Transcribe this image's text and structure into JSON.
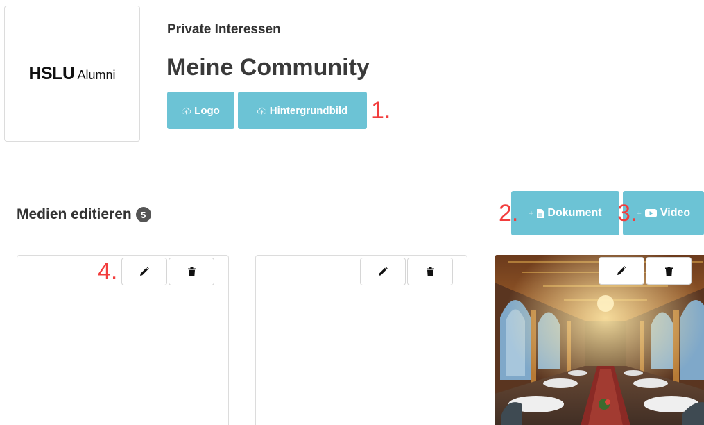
{
  "logo": {
    "main": "HSLU",
    "sub": "Alumni"
  },
  "header": {
    "subtitle": "Private Interessen",
    "title": "Meine Community"
  },
  "upload_buttons": {
    "logo_label": "Logo",
    "background_label": "Hintergrundbild",
    "icon": "cloud-upload-icon"
  },
  "annotations": {
    "a1": "1.",
    "a2": "2.",
    "a3": "3.",
    "a4": "4."
  },
  "media": {
    "section_title": "Medien editieren",
    "count": "5",
    "add_document_label": "Dokument",
    "add_video_label": "Video",
    "plus": "+",
    "cards": [
      {
        "image": "empty"
      },
      {
        "image": "empty"
      },
      {
        "image": "restaurant-hall-photo"
      }
    ]
  },
  "colors": {
    "button": "#6cc3d5",
    "annotation": "#f23d3d",
    "badge": "#555555",
    "border": "#dcdcdc"
  }
}
